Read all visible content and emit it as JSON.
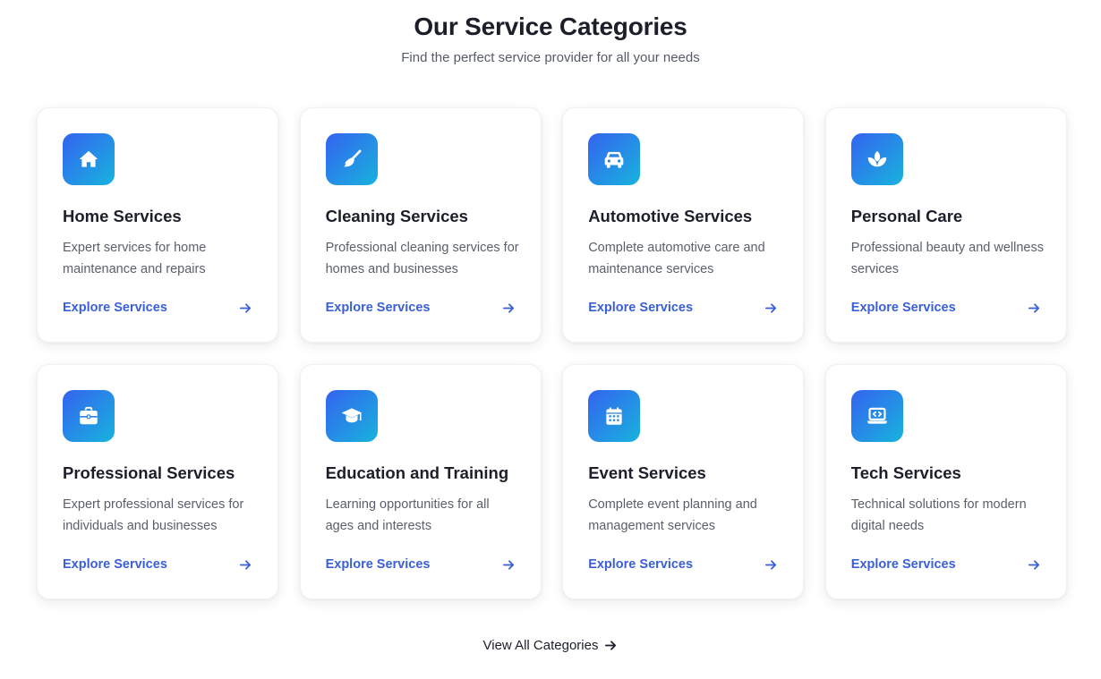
{
  "header": {
    "title": "Our Service Categories",
    "subtitle": "Find the perfect service provider for all your needs"
  },
  "categories": [
    {
      "icon": "home-icon",
      "title": "Home Services",
      "description": "Expert services for home maintenance and repairs",
      "link_label": "Explore Services"
    },
    {
      "icon": "broom-icon",
      "title": "Cleaning Services",
      "description": "Professional cleaning services for homes and businesses",
      "link_label": "Explore Services"
    },
    {
      "icon": "car-icon",
      "title": "Automotive Services",
      "description": "Complete automotive care and maintenance services",
      "link_label": "Explore Services"
    },
    {
      "icon": "spa-icon",
      "title": "Personal Care",
      "description": "Professional beauty and wellness services",
      "link_label": "Explore Services"
    },
    {
      "icon": "briefcase-icon",
      "title": "Professional Services",
      "description": "Expert professional services for individuals and businesses",
      "link_label": "Explore Services"
    },
    {
      "icon": "graduation-cap-icon",
      "title": "Education and Training",
      "description": "Learning opportunities for all ages and interests",
      "link_label": "Explore Services"
    },
    {
      "icon": "calendar-icon",
      "title": "Event Services",
      "description": "Complete event planning and management services",
      "link_label": "Explore Services"
    },
    {
      "icon": "laptop-code-icon",
      "title": "Tech Services",
      "description": "Technical solutions for modern digital needs",
      "link_label": "Explore Services"
    }
  ],
  "footer": {
    "view_all_label": "View All Categories"
  },
  "colors": {
    "accent": "#3a5fd6",
    "icon_gradient_start": "#3463f0",
    "icon_gradient_end": "#18b3dd",
    "heading": "#1c1f2a",
    "body_text": "#5a606b"
  }
}
